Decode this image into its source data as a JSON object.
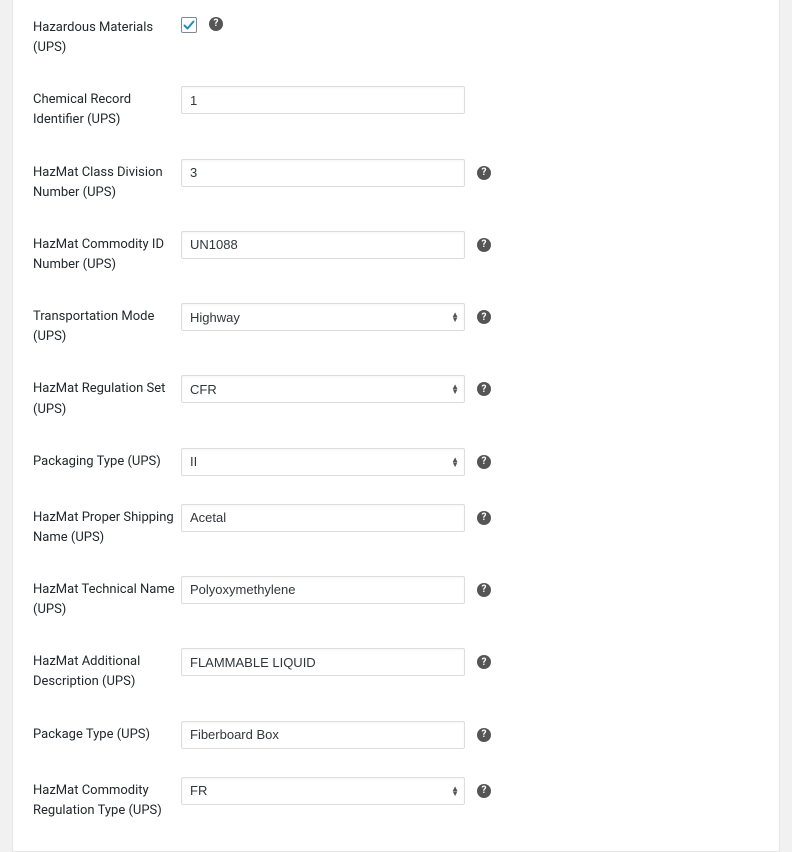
{
  "fields": {
    "hazmat_checkbox": {
      "label": "Hazardous Materials (UPS)",
      "checked": true
    },
    "chem_record": {
      "label": "Chemical Record Identifier (UPS)",
      "value": "1"
    },
    "class_division": {
      "label": "HazMat Class Division Number (UPS)",
      "value": "3"
    },
    "commodity_id": {
      "label": "HazMat Commodity ID Number (UPS)",
      "value": "UN1088"
    },
    "trans_mode": {
      "label": "Transportation Mode (UPS)",
      "value": "Highway"
    },
    "reg_set": {
      "label": "HazMat Regulation Set (UPS)",
      "value": "CFR"
    },
    "packaging_type": {
      "label": "Packaging Type (UPS)",
      "value": "II"
    },
    "proper_ship": {
      "label": "HazMat Proper Shipping Name (UPS)",
      "value": "Acetal"
    },
    "technical_name": {
      "label": "HazMat Technical Name (UPS)",
      "value": "Polyoxymethylene"
    },
    "additional_desc": {
      "label": "HazMat Additional Description (UPS)",
      "value": "FLAMMABLE LIQUID"
    },
    "package_type": {
      "label": "Package Type (UPS)",
      "value": "Fiberboard Box"
    },
    "commodity_reg_type": {
      "label": "HazMat Commodity Regulation Type (UPS)",
      "value": "FR"
    }
  }
}
